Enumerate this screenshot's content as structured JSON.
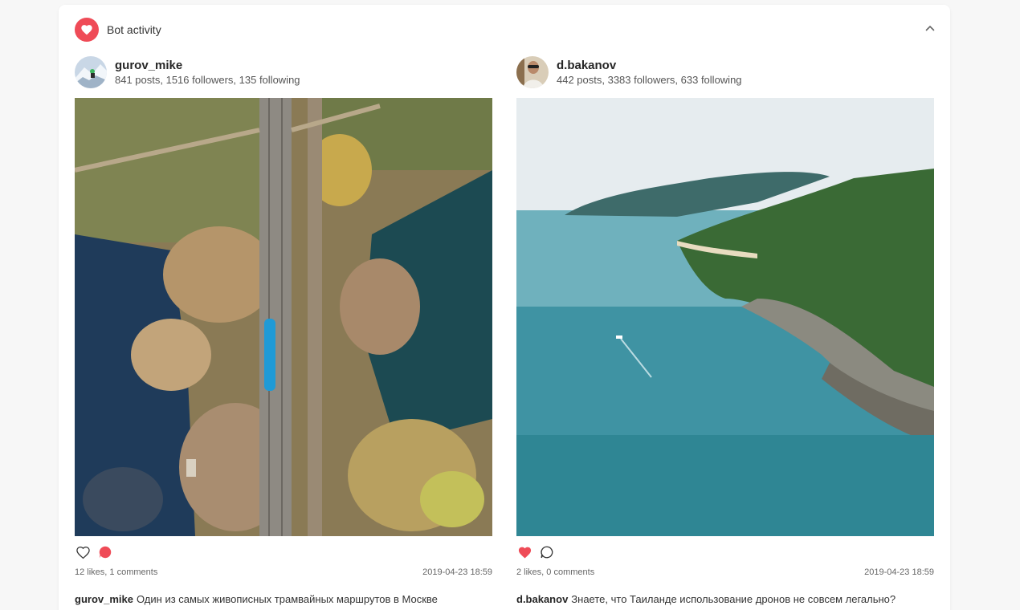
{
  "panel": {
    "title": "Bot activity",
    "icon": "heart-icon",
    "accent": "#ef4b57"
  },
  "posts": [
    {
      "username": "gurov_mike",
      "stats": "841 posts, 1516 followers, 135 following",
      "liked": false,
      "commented": true,
      "counts": "12 likes, 1 comments",
      "date": "2019-04-23 18:59",
      "caption_user": "gurov_mike",
      "caption_text": "Один из самых живописных трамвайных маршрутов в Москве"
    },
    {
      "username": "d.bakanov",
      "stats": "442 posts, 3383 followers, 633 following",
      "liked": true,
      "commented": false,
      "counts": "2 likes, 0 comments",
      "date": "2019-04-23 18:59",
      "caption_user": "d.bakanov",
      "caption_text": "Знаете, что Таиланде использование дронов не совсем легально?"
    }
  ]
}
